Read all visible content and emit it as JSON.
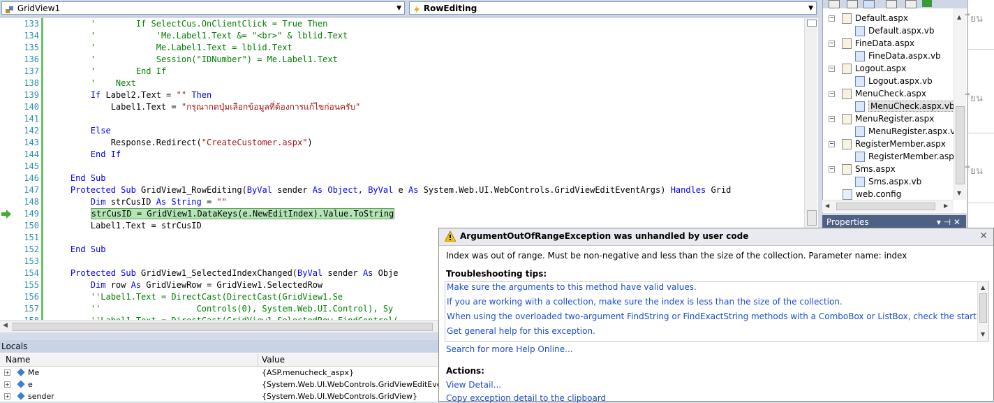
{
  "navbar": {
    "class_combo": "GridView1",
    "method_combo": "RowEditing"
  },
  "code_lines": [
    {
      "num": "133",
      "parts": [
        {
          "t": "        '        If SelectCus.OnClientClick = True Then",
          "c": "cm"
        }
      ]
    },
    {
      "num": "134",
      "parts": [
        {
          "t": "        '            'Me.Label1.Text &= \"<br>\" & lblid.Text",
          "c": "cm"
        }
      ]
    },
    {
      "num": "135",
      "parts": [
        {
          "t": "        '            Me.Label1.Text = lblid.Text",
          "c": "cm"
        }
      ]
    },
    {
      "num": "136",
      "parts": [
        {
          "t": "        '            Session(\"IDNumber\") = Me.Label1.Text",
          "c": "cm"
        }
      ]
    },
    {
      "num": "137",
      "parts": [
        {
          "t": "        '        End If",
          "c": "cm"
        }
      ]
    },
    {
      "num": "138",
      "parts": [
        {
          "t": "        '    Next",
          "c": "cm"
        }
      ]
    },
    {
      "num": "139",
      "parts": [
        {
          "t": "        "
        },
        {
          "t": "If",
          "c": "kw"
        },
        {
          "t": " Label2.Text = "
        },
        {
          "t": "\"\"",
          "c": "st"
        },
        {
          "t": " "
        },
        {
          "t": "Then",
          "c": "kw"
        }
      ]
    },
    {
      "num": "140",
      "parts": [
        {
          "t": "            Label1.Text = "
        },
        {
          "t": "\"กรุณากดปุ่มเลือกข้อมูลที่ต้องการแก้ไขก่อนครับ\"",
          "c": "st"
        }
      ]
    },
    {
      "num": "141",
      "parts": [
        {
          "t": ""
        }
      ]
    },
    {
      "num": "142",
      "parts": [
        {
          "t": "        "
        },
        {
          "t": "Else",
          "c": "kw"
        }
      ]
    },
    {
      "num": "143",
      "parts": [
        {
          "t": "            Response.Redirect("
        },
        {
          "t": "\"CreateCustomer.aspx\"",
          "c": "st"
        },
        {
          "t": ")"
        }
      ]
    },
    {
      "num": "144",
      "parts": [
        {
          "t": "        "
        },
        {
          "t": "End If",
          "c": "kw"
        }
      ]
    },
    {
      "num": "145",
      "parts": [
        {
          "t": ""
        }
      ]
    },
    {
      "num": "146",
      "parts": [
        {
          "t": "    "
        },
        {
          "t": "End Sub",
          "c": "kw"
        }
      ]
    },
    {
      "num": "147",
      "parts": [
        {
          "t": "    "
        },
        {
          "t": "Protected Sub",
          "c": "kw"
        },
        {
          "t": " GridView1_RowEditing("
        },
        {
          "t": "ByVal",
          "c": "kw"
        },
        {
          "t": " sender "
        },
        {
          "t": "As Object",
          "c": "kw"
        },
        {
          "t": ", "
        },
        {
          "t": "ByVal",
          "c": "kw"
        },
        {
          "t": " e "
        },
        {
          "t": "As",
          "c": "kw"
        },
        {
          "t": " System.Web.UI.WebControls.GridViewEditEventArgs) "
        },
        {
          "t": "Handles",
          "c": "kw"
        },
        {
          "t": " Grid"
        }
      ]
    },
    {
      "num": "148",
      "parts": [
        {
          "t": "        "
        },
        {
          "t": "Dim",
          "c": "kw"
        },
        {
          "t": " strCusID "
        },
        {
          "t": "As String",
          "c": "kw"
        },
        {
          "t": " = "
        },
        {
          "t": "\"\"",
          "c": "st"
        }
      ]
    },
    {
      "num": "149",
      "parts": [
        {
          "t": "        "
        },
        {
          "t": "strCusID = GridView1.DataKeys(e.NewEditIndex).Value.ToString",
          "c": "hl"
        }
      ]
    },
    {
      "num": "150",
      "parts": [
        {
          "t": "        Label1.Text = strCusID"
        }
      ]
    },
    {
      "num": "151",
      "parts": [
        {
          "t": ""
        }
      ]
    },
    {
      "num": "152",
      "parts": [
        {
          "t": "    "
        },
        {
          "t": "End Sub",
          "c": "kw"
        }
      ]
    },
    {
      "num": "153",
      "parts": [
        {
          "t": ""
        }
      ]
    },
    {
      "num": "154",
      "parts": [
        {
          "t": "    "
        },
        {
          "t": "Protected Sub",
          "c": "kw"
        },
        {
          "t": " GridView1_SelectedIndexChanged("
        },
        {
          "t": "ByVal",
          "c": "kw"
        },
        {
          "t": " sender "
        },
        {
          "t": "As",
          "c": "kw"
        },
        {
          "t": " Obje"
        }
      ]
    },
    {
      "num": "155",
      "parts": [
        {
          "t": "        "
        },
        {
          "t": "Dim",
          "c": "kw"
        },
        {
          "t": " row "
        },
        {
          "t": "As",
          "c": "kw"
        },
        {
          "t": " GridViewRow = GridView1.SelectedRow"
        }
      ]
    },
    {
      "num": "156",
      "parts": [
        {
          "t": "        ''Label1.Text = DirectCast(DirectCast(GridView1.Se",
          "c": "cm"
        }
      ]
    },
    {
      "num": "157",
      "parts": [
        {
          "t": "        ''                   Controls(0), System.Web.UI.Control), Sy",
          "c": "cm"
        }
      ]
    },
    {
      "num": "158",
      "parts": [
        {
          "t": "        ''Label1.Text = DirectCast(GridView1.SelectedRow.FindControl(",
          "c": "cm"
        }
      ]
    }
  ],
  "locals": {
    "title": "Locals",
    "col_name": "Name",
    "col_value": "Value",
    "rows": [
      {
        "name": "Me",
        "value": "{ASP.menucheck_aspx}"
      },
      {
        "name": "e",
        "value": "{System.Web.UI.WebControls.GridViewEditEventArgs}"
      },
      {
        "name": "sender",
        "value": "{System.Web.UI.WebControls.GridView}"
      }
    ]
  },
  "solution": {
    "items": [
      {
        "label": "Default.aspx",
        "level": 0
      },
      {
        "label": "Default.aspx.vb",
        "level": 1
      },
      {
        "label": "FineData.aspx",
        "level": 0
      },
      {
        "label": "FineData.aspx.vb",
        "level": 1
      },
      {
        "label": "Logout.aspx",
        "level": 0
      },
      {
        "label": "Logout.aspx.vb",
        "level": 1
      },
      {
        "label": "MenuCheck.aspx",
        "level": 0
      },
      {
        "label": "MenuCheck.aspx.vb",
        "level": 1,
        "selected": true
      },
      {
        "label": "MenuRegister.aspx",
        "level": 0
      },
      {
        "label": "MenuRegister.aspx.vb",
        "level": 1
      },
      {
        "label": "RegisterMember.aspx",
        "level": 0
      },
      {
        "label": "RegisterMember.aspx.",
        "level": 1
      },
      {
        "label": "Sms.aspx",
        "level": 0
      },
      {
        "label": "Sms.aspx.vb",
        "level": 1
      },
      {
        "label": "web.config",
        "level": 0,
        "config": true
      }
    ]
  },
  "properties": {
    "title": "Properties",
    "pin": "▾ ⊣ ✕"
  },
  "right_fragment": "ียน",
  "exception": {
    "title": "ArgumentOutOfRangeException was unhandled by user code",
    "message": "Index was out of range. Must be non-negative and less than the size of the collection. Parameter name: index",
    "tips_heading": "Troubleshooting tips:",
    "tips": [
      "Make sure the arguments to this method have valid values.",
      "If you are working with a collection, make sure the index is less than the size of the collection.",
      "When using the overloaded two-argument FindString or FindExactString methods with a ComboBox or ListBox, check the startIndex parameter.",
      "Get general help for this exception."
    ],
    "search_link": "Search for more Help Online...",
    "actions_heading": "Actions:",
    "actions": [
      "View Detail...",
      "Copy exception detail to the clipboard"
    ]
  },
  "colors": {
    "keyword": "#0000ff",
    "comment": "#008000",
    "string": "#a31515",
    "link": "#1a4ed0",
    "linenum": "#2b91af"
  }
}
